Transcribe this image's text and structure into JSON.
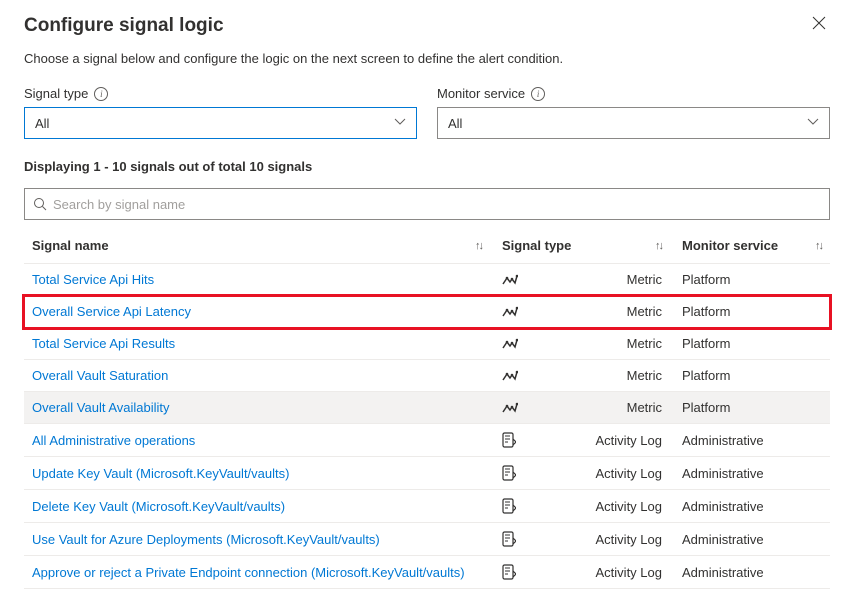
{
  "header": {
    "title": "Configure signal logic",
    "subtitle": "Choose a signal below and configure the logic on the next screen to define the alert condition."
  },
  "filters": {
    "signal_type": {
      "label": "Signal type",
      "value": "All"
    },
    "monitor_service": {
      "label": "Monitor service",
      "value": "All"
    }
  },
  "result_text": "Displaying 1 - 10 signals out of total 10 signals",
  "search": {
    "placeholder": "Search by signal name"
  },
  "columns": {
    "name": "Signal name",
    "type": "Signal type",
    "service": "Monitor service"
  },
  "rows": [
    {
      "name": "Total Service Api Hits",
      "type": "Metric",
      "service": "Platform",
      "icon": "metric"
    },
    {
      "name": "Overall Service Api Latency",
      "type": "Metric",
      "service": "Platform",
      "icon": "metric",
      "highlighted": true
    },
    {
      "name": "Total Service Api Results",
      "type": "Metric",
      "service": "Platform",
      "icon": "metric"
    },
    {
      "name": "Overall Vault Saturation",
      "type": "Metric",
      "service": "Platform",
      "icon": "metric"
    },
    {
      "name": "Overall Vault Availability",
      "type": "Metric",
      "service": "Platform",
      "icon": "metric",
      "hovered": true
    },
    {
      "name": "All Administrative operations",
      "type": "Activity Log",
      "service": "Administrative",
      "icon": "activity"
    },
    {
      "name": "Update Key Vault (Microsoft.KeyVault/vaults)",
      "type": "Activity Log",
      "service": "Administrative",
      "icon": "activity"
    },
    {
      "name": "Delete Key Vault (Microsoft.KeyVault/vaults)",
      "type": "Activity Log",
      "service": "Administrative",
      "icon": "activity"
    },
    {
      "name": "Use Vault for Azure Deployments (Microsoft.KeyVault/vaults)",
      "type": "Activity Log",
      "service": "Administrative",
      "icon": "activity"
    },
    {
      "name": "Approve or reject a Private Endpoint connection (Microsoft.KeyVault/vaults)",
      "type": "Activity Log",
      "service": "Administrative",
      "icon": "activity"
    }
  ]
}
